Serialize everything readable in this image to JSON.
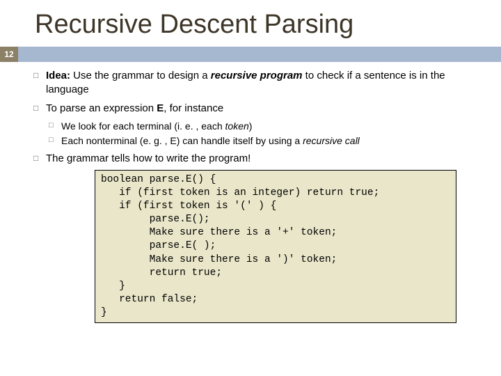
{
  "title": "Recursive Descent Parsing",
  "pageNumber": "12",
  "b1": {
    "lead": "Idea:",
    "t1": " Use the grammar to design a ",
    "em": "recursive program",
    "t2": " to check if a sentence is in the language"
  },
  "b2": {
    "t1": "To parse an expression ",
    "bold": "E",
    "t2": ", for instance"
  },
  "b2a": {
    "t1": "We look for each terminal (i. e. , each ",
    "em": "token",
    "t2": ")"
  },
  "b2b": {
    "t1": "Each nonterminal (e. g. , E) can handle itself by using a ",
    "em": "recursive call"
  },
  "b3": {
    "t1": "The grammar tells how to write the program!"
  },
  "code": "boolean parse.E() {\n   if (first token is an integer) return true;\n   if (first token is '(' ) {\n        parse.E();\n        Make sure there is a '+' token;\n        parse.E( );\n        Make sure there is a ')' token;\n        return true;\n   }\n   return false;\n}"
}
